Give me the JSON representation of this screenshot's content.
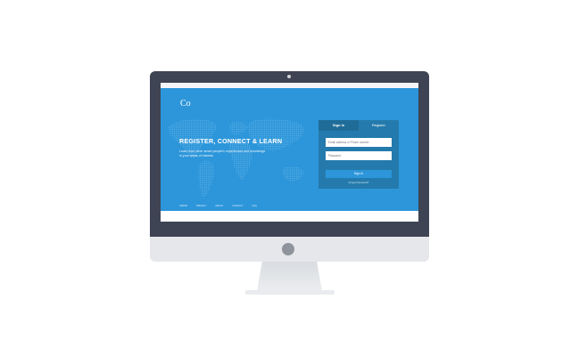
{
  "site": {
    "logo": "Co",
    "headline": "REGISTER, CONNECT & LEARN",
    "subtext": "Learn from other smart people's experiences and knowledge in your areas of interest."
  },
  "login": {
    "tabs": [
      {
        "label": "Sign In",
        "active": true
      },
      {
        "label": "Register",
        "active": false
      }
    ],
    "email_placeholder": "Email address or Phone number",
    "password_placeholder": "Password",
    "signin_label": "Sign In",
    "forgot_label": "Forgot Password?"
  },
  "footer": {
    "links": [
      "TERMS",
      "PRIVACY",
      "ABOUT",
      "CONTACT",
      "FAQ"
    ]
  },
  "colors": {
    "hero_blue": "#2d96da",
    "panel_blue": "#247aac",
    "bezel": "#3e4453"
  }
}
